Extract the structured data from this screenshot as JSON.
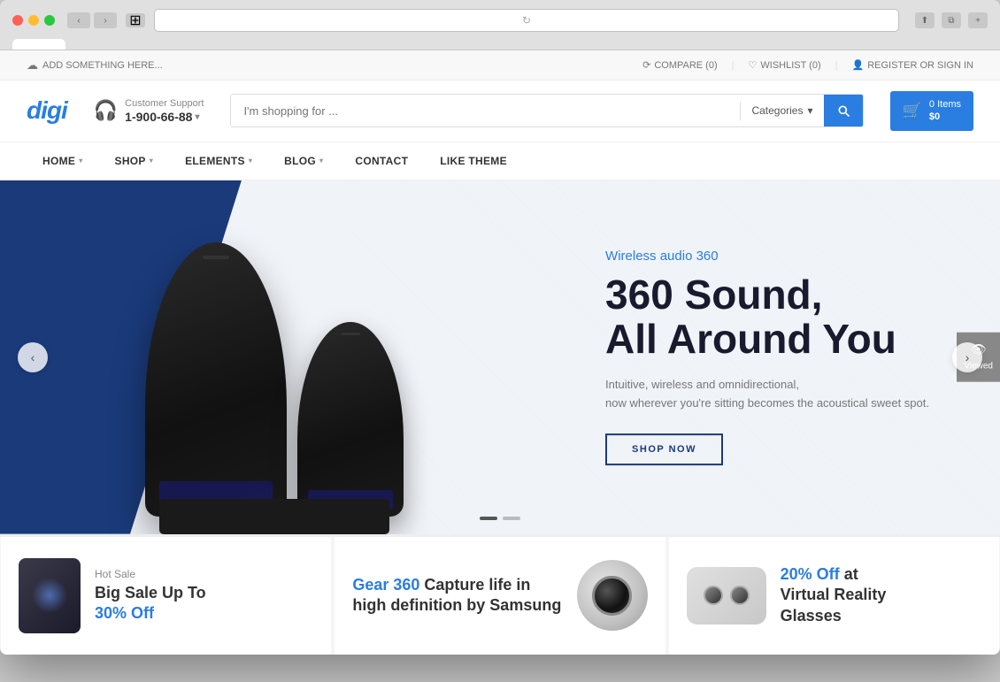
{
  "browser": {
    "tab_label": ""
  },
  "topbar": {
    "left_text": "ADD SOMETHING HERE...",
    "compare_text": "COMPARE (0)",
    "wishlist_text": "WISHLIST (0)",
    "register_text": "REGISTER OR SIGN IN"
  },
  "header": {
    "logo": "digi",
    "support_label": "Customer Support",
    "support_phone": "1-900-66-88",
    "search_placeholder": "I'm shopping for ...",
    "categories_label": "Categories",
    "cart_items": "0 Items",
    "cart_price": "$0"
  },
  "nav": {
    "items": [
      {
        "label": "HOME",
        "has_arrow": true
      },
      {
        "label": "SHOP",
        "has_arrow": true
      },
      {
        "label": "ELEMENTS",
        "has_arrow": true
      },
      {
        "label": "BLOG",
        "has_arrow": true
      },
      {
        "label": "CONTACT",
        "has_arrow": false
      },
      {
        "label": "LIKE THEME",
        "has_arrow": false
      }
    ]
  },
  "hero": {
    "subtitle": "Wireless audio 360",
    "title_line1": "360 Sound,",
    "title_line2": "All Around You",
    "description": "Intuitive, wireless and omnidirectional,\nnow wherever you're sitting becomes the acoustical sweet spot.",
    "cta_label": "SHOP NOW"
  },
  "slider_dots": [
    {
      "active": true
    },
    {
      "active": false
    }
  ],
  "viewed_label": "Viewed",
  "promo_cards": [
    {
      "label": "Hot Sale",
      "title_line1": "Big Sale Up To",
      "highlight": "30% Off",
      "type": "phone"
    },
    {
      "highlight": "Gear 360",
      "title": "Capture life in high definition by Samsung",
      "type": "camera"
    },
    {
      "highlight": "20% Off",
      "suffix": " at",
      "title_line1": "Virtual Reality",
      "title_line2": "Glasses",
      "type": "vr"
    }
  ]
}
